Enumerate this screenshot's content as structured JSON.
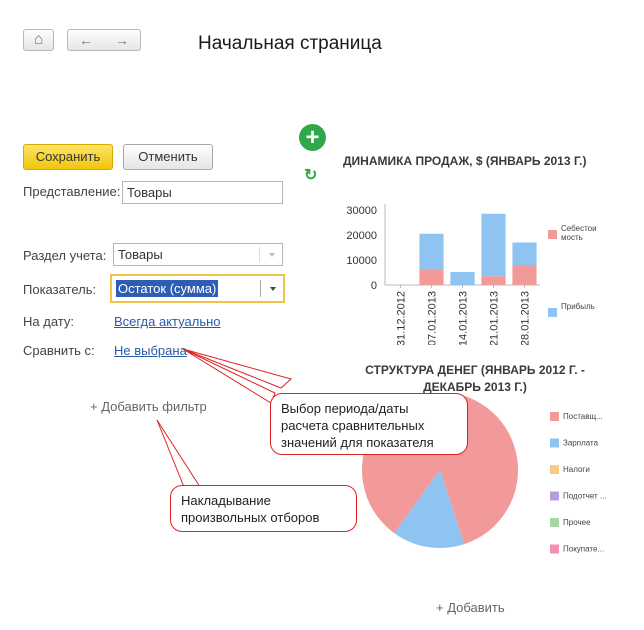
{
  "toolbar": {
    "home_icon": "⌂",
    "back_icon": "←",
    "forward_icon": "→"
  },
  "page_title": "Начальная страница",
  "actions": {
    "add_icon": "+",
    "refresh_icon": "↻",
    "save_label": "Сохранить",
    "cancel_label": "Отменить"
  },
  "form": {
    "presentation_label": "Представление:",
    "presentation_value": "Товары",
    "section_label": "Раздел учета:",
    "section_value": "Товары",
    "indicator_label": "Показатель:",
    "indicator_value": "Остаток (сумма)",
    "date_label": "На дату:",
    "date_value": "Всегда актуально",
    "compare_label": "Сравнить с:",
    "compare_value": "Не выбрана",
    "add_filter": "+ Добавить фильтр"
  },
  "callouts": {
    "period": "Выбор периода/даты расчета сравнительных значений для показателя",
    "filters": "Накладывание произвольных отборов"
  },
  "add_label": "+ Добавить",
  "colors": {
    "accent_green": "#2ea84a",
    "save_yellow": "#f5d021",
    "link_blue": "#2a5aa8",
    "callout_red": "#d22222",
    "series_pink": "#f29a9a",
    "series_blue": "#8fc3f2"
  },
  "chart_data": [
    {
      "type": "bar",
      "title": "ДИНАМИКА ПРОДАЖ, $ (ЯНВАРЬ 2013 Г.)",
      "categories": [
        "31.12.2012",
        "07.01.2013",
        "14.01.2013",
        "21.01.2013",
        "28.01.2013"
      ],
      "stacked": true,
      "series": [
        {
          "name": "Себестоимость",
          "color": "#f29a9a",
          "values": [
            0,
            6000,
            0,
            3500,
            8000
          ]
        },
        {
          "name": "Прибыль",
          "color": "#8fc3f2",
          "values": [
            0,
            14500,
            5200,
            25000,
            9000
          ]
        }
      ],
      "yticks": [
        0,
        10000,
        20000,
        30000
      ],
      "ylim": [
        0,
        30000
      ],
      "legend_labels": [
        "Себестоимость",
        "Прибыль"
      ]
    },
    {
      "type": "pie",
      "title": "СТРУКТУРА ДЕНЕГ (ЯНВАРЬ 2012 Г. - ДЕКАБРЬ 2013 Г.)",
      "title_lines": [
        "СТРУКТУРА ДЕНЕГ (ЯНВАРЬ 2012 Г. -",
        "ДЕКАБРЬ 2013 Г.)"
      ],
      "slices": [
        {
          "label": "Поставщ...",
          "value": 85,
          "color": "#f29a9a"
        },
        {
          "label": "Зарплата",
          "value": 15,
          "color": "#8fc3f2"
        },
        {
          "label": "Налоги",
          "value": 0,
          "color": "#f7c98a"
        },
        {
          "label": "Подотчет ...",
          "value": 0,
          "color": "#b39ddb"
        },
        {
          "label": "Прочее",
          "value": 0,
          "color": "#a5d6a7"
        },
        {
          "label": "Покупате...",
          "value": 0,
          "color": "#f48fb1"
        }
      ]
    }
  ]
}
